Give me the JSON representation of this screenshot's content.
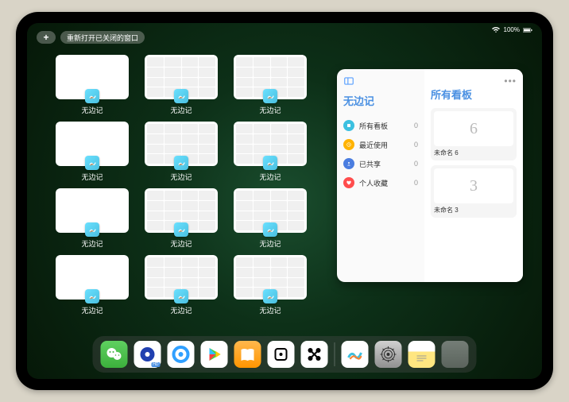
{
  "status": {
    "battery": "100%"
  },
  "topbar": {
    "plus": "+",
    "reopen_label": "重新打开已关闭的窗口"
  },
  "windows": [
    {
      "label": "无边记",
      "style": "blank"
    },
    {
      "label": "无边记",
      "style": "calendar"
    },
    {
      "label": "无边记",
      "style": "calendar"
    },
    {
      "label": "无边记",
      "style": "blank"
    },
    {
      "label": "无边记",
      "style": "calendar"
    },
    {
      "label": "无边记",
      "style": "calendar"
    },
    {
      "label": "无边记",
      "style": "blank"
    },
    {
      "label": "无边记",
      "style": "calendar"
    },
    {
      "label": "无边记",
      "style": "calendar"
    },
    {
      "label": "无边记",
      "style": "blank"
    },
    {
      "label": "无边记",
      "style": "calendar"
    },
    {
      "label": "无边记",
      "style": "calendar"
    }
  ],
  "panel": {
    "left_title": "无边记",
    "right_title": "所有看板",
    "nav": [
      {
        "label": "所有看板",
        "count": "0",
        "color": "#3cc0e0"
      },
      {
        "label": "最近使用",
        "count": "0",
        "color": "#ffb300"
      },
      {
        "label": "已共享",
        "count": "0",
        "color": "#4a7de0"
      },
      {
        "label": "个人收藏",
        "count": "0",
        "color": "#ff4d4d"
      }
    ],
    "boards": [
      {
        "name": "未命名 6",
        "date": "",
        "glyph": "6"
      },
      {
        "name": "未命名 3",
        "date": "",
        "glyph": "3"
      }
    ]
  },
  "dock": {
    "items": [
      {
        "name": "wechat"
      },
      {
        "name": "browser-hd"
      },
      {
        "name": "browser"
      },
      {
        "name": "play-store"
      },
      {
        "name": "books"
      },
      {
        "name": "dice"
      },
      {
        "name": "connect"
      },
      {
        "name": "freeform"
      },
      {
        "name": "settings"
      },
      {
        "name": "notes"
      },
      {
        "name": "app-folder"
      }
    ]
  }
}
